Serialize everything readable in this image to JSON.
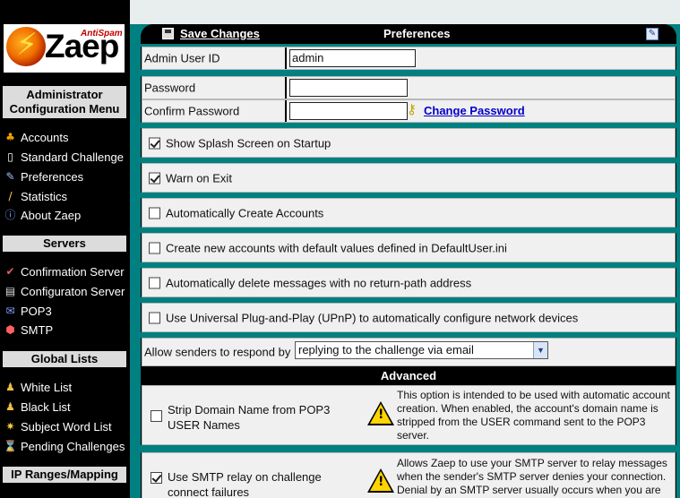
{
  "sidebar": {
    "logo": {
      "brand": "Zaep",
      "tagline": "AntiSpam"
    },
    "sections": [
      {
        "title": "Administrator Configuration Menu",
        "items": [
          {
            "label": "Accounts",
            "icon": "accounts-icon"
          },
          {
            "label": "Standard Challenge",
            "icon": "document-icon"
          },
          {
            "label": "Preferences",
            "icon": "preferences-icon"
          },
          {
            "label": "Statistics",
            "icon": "statistics-icon"
          },
          {
            "label": "About Zaep",
            "icon": "info-icon"
          }
        ]
      },
      {
        "title": "Servers",
        "items": [
          {
            "label": "Confirmation Server",
            "icon": "confirmation-server-icon"
          },
          {
            "label": "Configuraton Server",
            "icon": "configuration-server-icon"
          },
          {
            "label": "POP3",
            "icon": "pop3-icon"
          },
          {
            "label": "SMTP",
            "icon": "smtp-icon"
          }
        ]
      },
      {
        "title": "Global Lists",
        "items": [
          {
            "label": "White List",
            "icon": "white-list-icon"
          },
          {
            "label": "Black List",
            "icon": "black-list-icon"
          },
          {
            "label": "Subject Word List",
            "icon": "subject-word-list-icon"
          },
          {
            "label": "Pending Challenges",
            "icon": "pending-challenges-icon"
          }
        ]
      },
      {
        "title": "IP Ranges/Mapping",
        "items": []
      }
    ]
  },
  "toolbar": {
    "save_label": "Save Changes",
    "title": "Preferences"
  },
  "form": {
    "admin_user_id": {
      "label": "Admin User ID",
      "value": "admin"
    },
    "password": {
      "label": "Password",
      "value": ""
    },
    "confirm_password": {
      "label": "Confirm Password",
      "value": ""
    },
    "change_password_link": "Change Password",
    "options": [
      {
        "label": "Show Splash Screen on Startup",
        "checked": true
      },
      {
        "label": "Warn on Exit",
        "checked": true
      },
      {
        "label": "Automatically Create Accounts",
        "checked": false
      },
      {
        "label": "Create new accounts with default values defined in DefaultUser.ini",
        "checked": false
      },
      {
        "label": "Automatically delete messages with no return-path address",
        "checked": false
      },
      {
        "label": "Use Universal Plug-and-Play (UPnP) to automatically configure network devices",
        "checked": false
      }
    ],
    "respond": {
      "label": "Allow senders to respond by",
      "selected": "replying to the challenge via email"
    }
  },
  "advanced": {
    "title": "Advanced",
    "items": [
      {
        "label": "Strip Domain Name from POP3 USER Names",
        "checked": false,
        "description": "This option is intended to be used with automatic account creation. When enabled, the account's domain name is stripped from the USER command sent to the POP3 server."
      },
      {
        "label": "Use SMTP relay on challenge connect failures",
        "checked": true,
        "description": "Allows Zaep to use your SMTP server to relay messages when the sender's SMTP server denies your connection. Denial by an SMTP server usually occurs when you are"
      }
    ]
  }
}
